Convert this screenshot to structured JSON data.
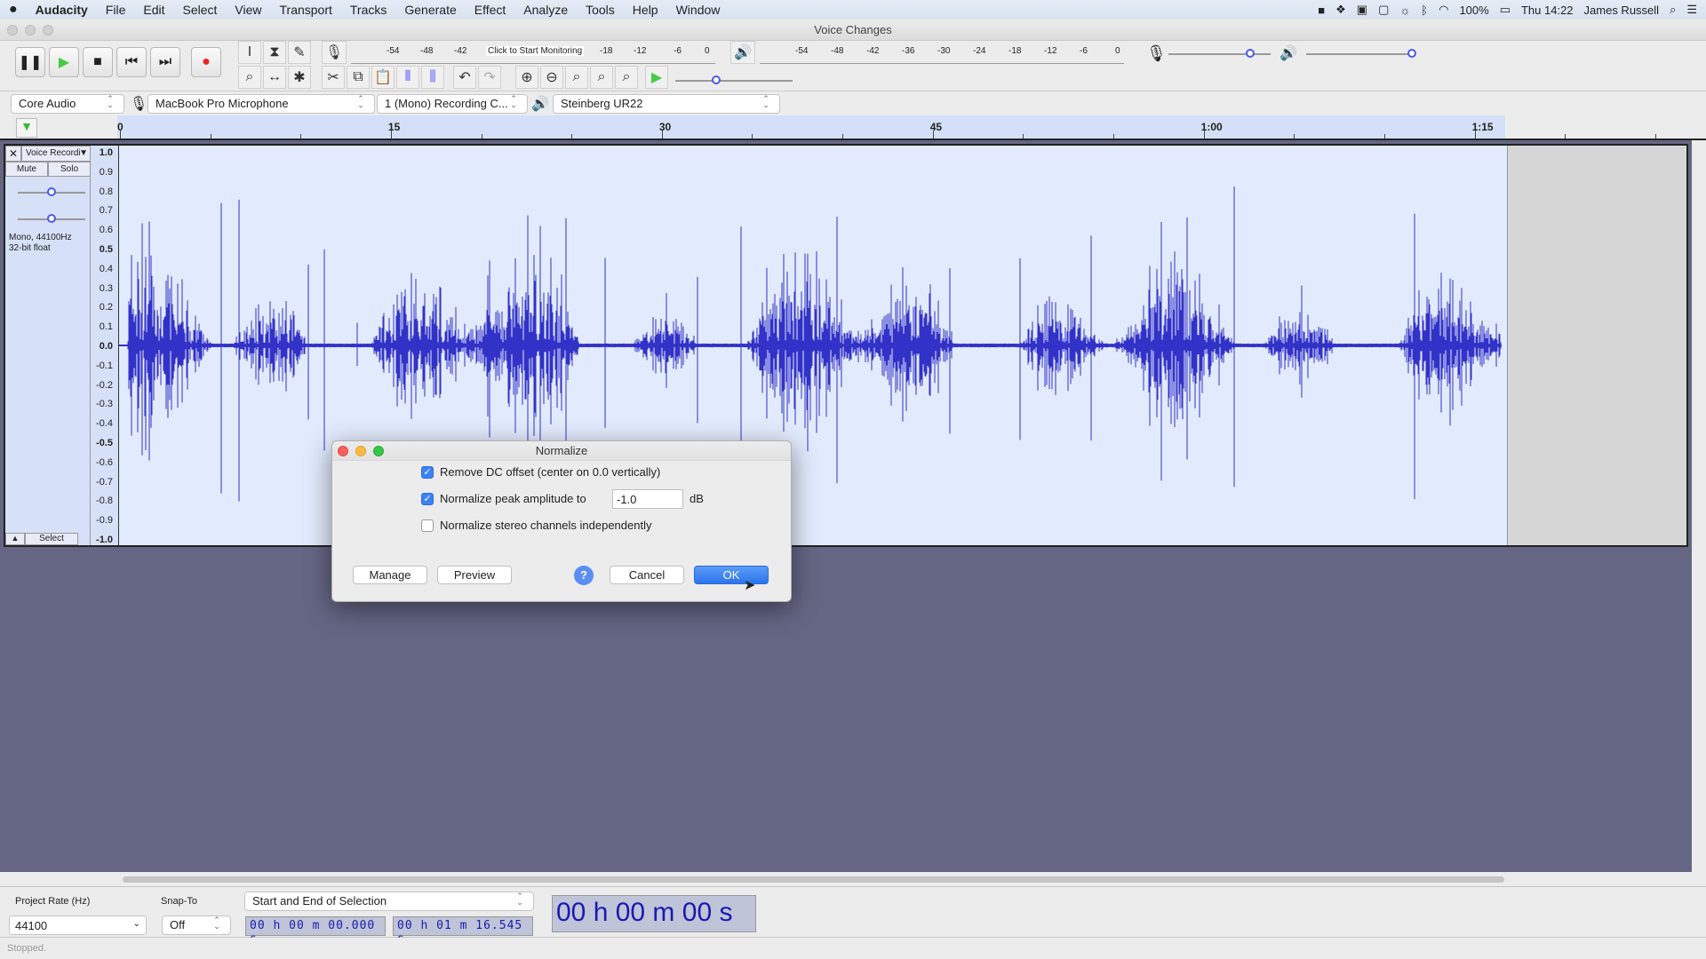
{
  "menubar": {
    "app": "Audacity",
    "items": [
      "File",
      "Edit",
      "Select",
      "View",
      "Transport",
      "Tracks",
      "Generate",
      "Effect",
      "Analyze",
      "Tools",
      "Help",
      "Window"
    ],
    "battery": "100%",
    "clock": "Thu 14:22",
    "user": "James Russell"
  },
  "window": {
    "title": "Voice Changes"
  },
  "meters": {
    "record_hint": "Click to Start Monitoring",
    "record_ticks": [
      "-54",
      "-48",
      "-42",
      "-18",
      "-12",
      "-6",
      "0"
    ],
    "play_ticks": [
      "-54",
      "-48",
      "-42",
      "-36",
      "-30",
      "-24",
      "-18",
      "-12",
      "-6",
      "0"
    ],
    "record_level": 0.8,
    "playback_level": 1.0,
    "play_speed": 0.35
  },
  "devices": {
    "host": "Core Audio",
    "input": "MacBook Pro Microphone",
    "channels": "1 (Mono) Recording C...",
    "output": "Steinberg UR22"
  },
  "ruler": {
    "labels": [
      "0",
      "15",
      "30",
      "45",
      "1:00",
      "1:15"
    ]
  },
  "track": {
    "name": "Voice Recordi",
    "mute": "Mute",
    "solo": "Solo",
    "info1": "Mono, 44100Hz",
    "info2": "32-bit float",
    "select": "Select",
    "gain": 0.5,
    "pan": 0.5,
    "scale": [
      "1.0",
      "0.9",
      "0.8",
      "0.7",
      "0.6",
      "0.5",
      "0.4",
      "0.3",
      "0.2",
      "0.1",
      "0.0",
      "-0.1",
      "-0.2",
      "-0.3",
      "-0.4",
      "-0.5",
      "-0.6",
      "-0.7",
      "-0.8",
      "-0.9",
      "-1.0"
    ],
    "duration_s": 76.545,
    "color": "#3232c8"
  },
  "dialog": {
    "title": "Normalize",
    "opt1": "Remove DC offset (center on 0.0 vertically)",
    "opt1_checked": true,
    "opt2": "Normalize peak amplitude to",
    "opt2_checked": true,
    "amplitude": "-1.0",
    "unit": "dB",
    "opt3": "Normalize stereo channels independently",
    "opt3_checked": false,
    "manage": "Manage",
    "preview": "Preview",
    "help": "?",
    "cancel": "Cancel",
    "ok": "OK"
  },
  "selection": {
    "rate_label": "Project Rate (Hz)",
    "rate": "44100",
    "snap_label": "Snap-To",
    "snap": "Off",
    "mode": "Start and End of Selection",
    "start": "00 h 00 m 00.000 s",
    "end": "00 h 01 m 16.545 s",
    "position": "00 h 00 m 00 s"
  },
  "status": "Stopped."
}
